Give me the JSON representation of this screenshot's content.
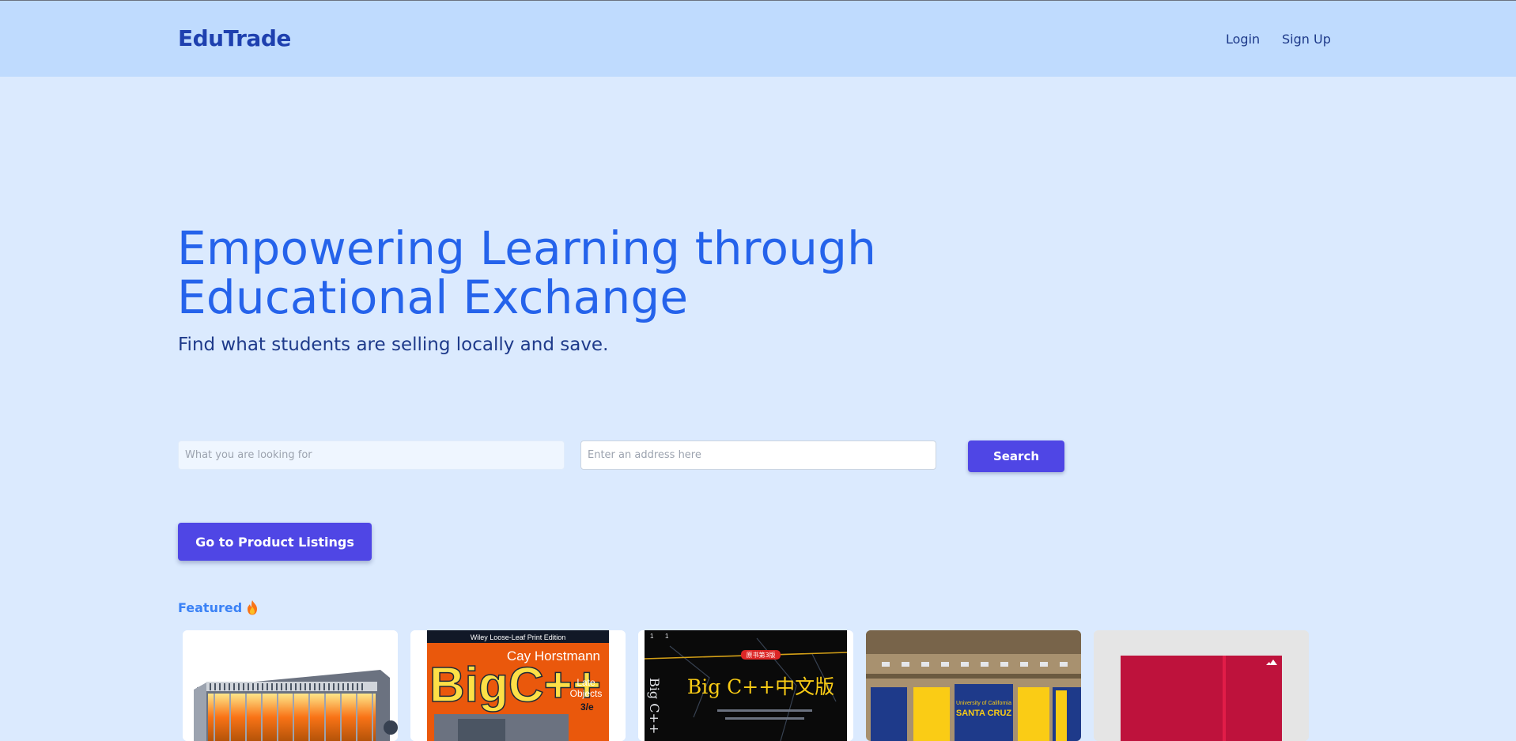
{
  "header": {
    "brand": "EduTrade",
    "nav": {
      "login": "Login",
      "signup": "Sign Up"
    }
  },
  "hero": {
    "title_line1": "Empowering Learning through",
    "title_line2": "Educational Exchange",
    "subtitle": "Find what students are selling locally and save."
  },
  "search": {
    "what_placeholder": "What you are looking for",
    "address_placeholder": "Enter an address here",
    "button_label": "Search"
  },
  "listings_button": "Go to Product Listings",
  "featured": {
    "label": "Featured",
    "icon": "fire-icon",
    "items": [
      {
        "image": "space-heater"
      },
      {
        "image": "big-cpp-late-objects-book",
        "cover_top": "Wiley Loose-Leaf Print Edition",
        "cover_author": "Cay Horstmann",
        "cover_title": "BigC++",
        "cover_sub1": "Late",
        "cover_sub2": "Objects",
        "cover_edition": "3/e"
      },
      {
        "image": "big-cpp-chinese-book",
        "cover_title": "Big C++中文版",
        "cover_badge": "原书第3版"
      },
      {
        "image": "ucsc-banners",
        "banner_text1": "University of California",
        "banner_text2": "SANTA CRUZ"
      },
      {
        "image": "red-book"
      }
    ]
  },
  "colors": {
    "header_bg": "#bfdbfe",
    "page_bg": "#dbeafe",
    "brand": "#1e40af",
    "hero_title": "#2563eb",
    "button": "#4f46e5",
    "featured": "#3b82f6"
  }
}
